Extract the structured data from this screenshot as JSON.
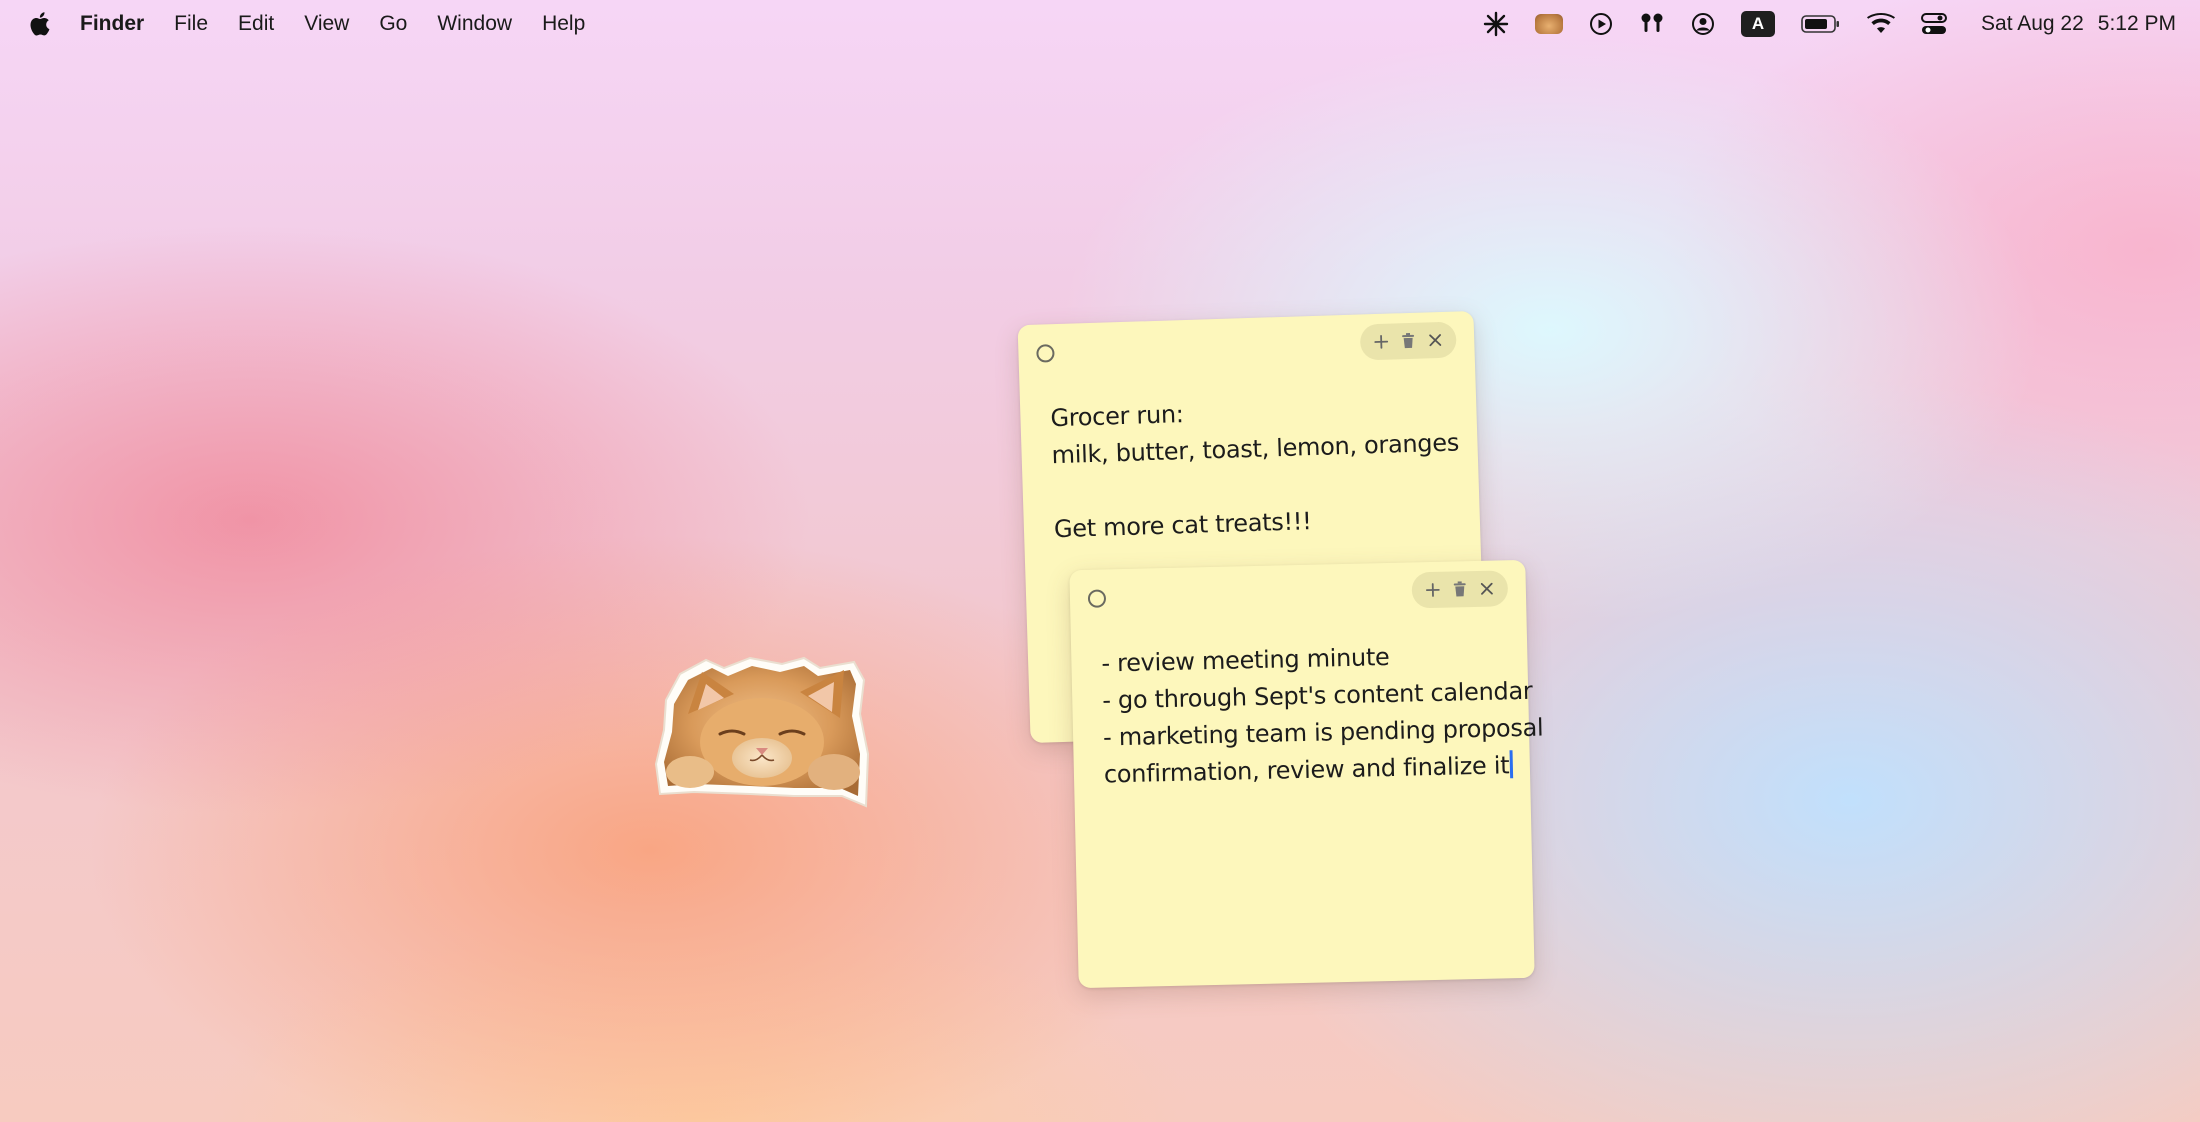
{
  "menubar": {
    "app_name": "Finder",
    "menus": [
      "File",
      "Edit",
      "View",
      "Go",
      "Window",
      "Help"
    ],
    "status_icons": [
      "sparkle-icon",
      "cat-thumbnail-icon",
      "play-circle-icon",
      "airpods-icon",
      "user-circle-icon",
      "keyboard-input-icon",
      "battery-icon",
      "wifi-icon",
      "control-center-icon"
    ],
    "keyboard_input": "A",
    "date": "Sat Aug 22",
    "time": "5:12 PM"
  },
  "notes": [
    {
      "lines": [
        "Grocer run:",
        "milk, butter, toast, lemon, oranges",
        "",
        "Get more cat treats!!!"
      ],
      "color": "#fdf7bc"
    },
    {
      "lines": [
        "- review meeting minute",
        "- go through Sept's content calendar",
        "- marketing team is pending proposal",
        "confirmation, review and finalize it"
      ],
      "color": "#fdf7bc"
    }
  ],
  "desktop": {
    "sticker": "cat-sticker"
  },
  "colors": {
    "note_background": "#fdf7bc",
    "caret": "#2a6ef0",
    "menubar_text": "#1a1a1a"
  }
}
